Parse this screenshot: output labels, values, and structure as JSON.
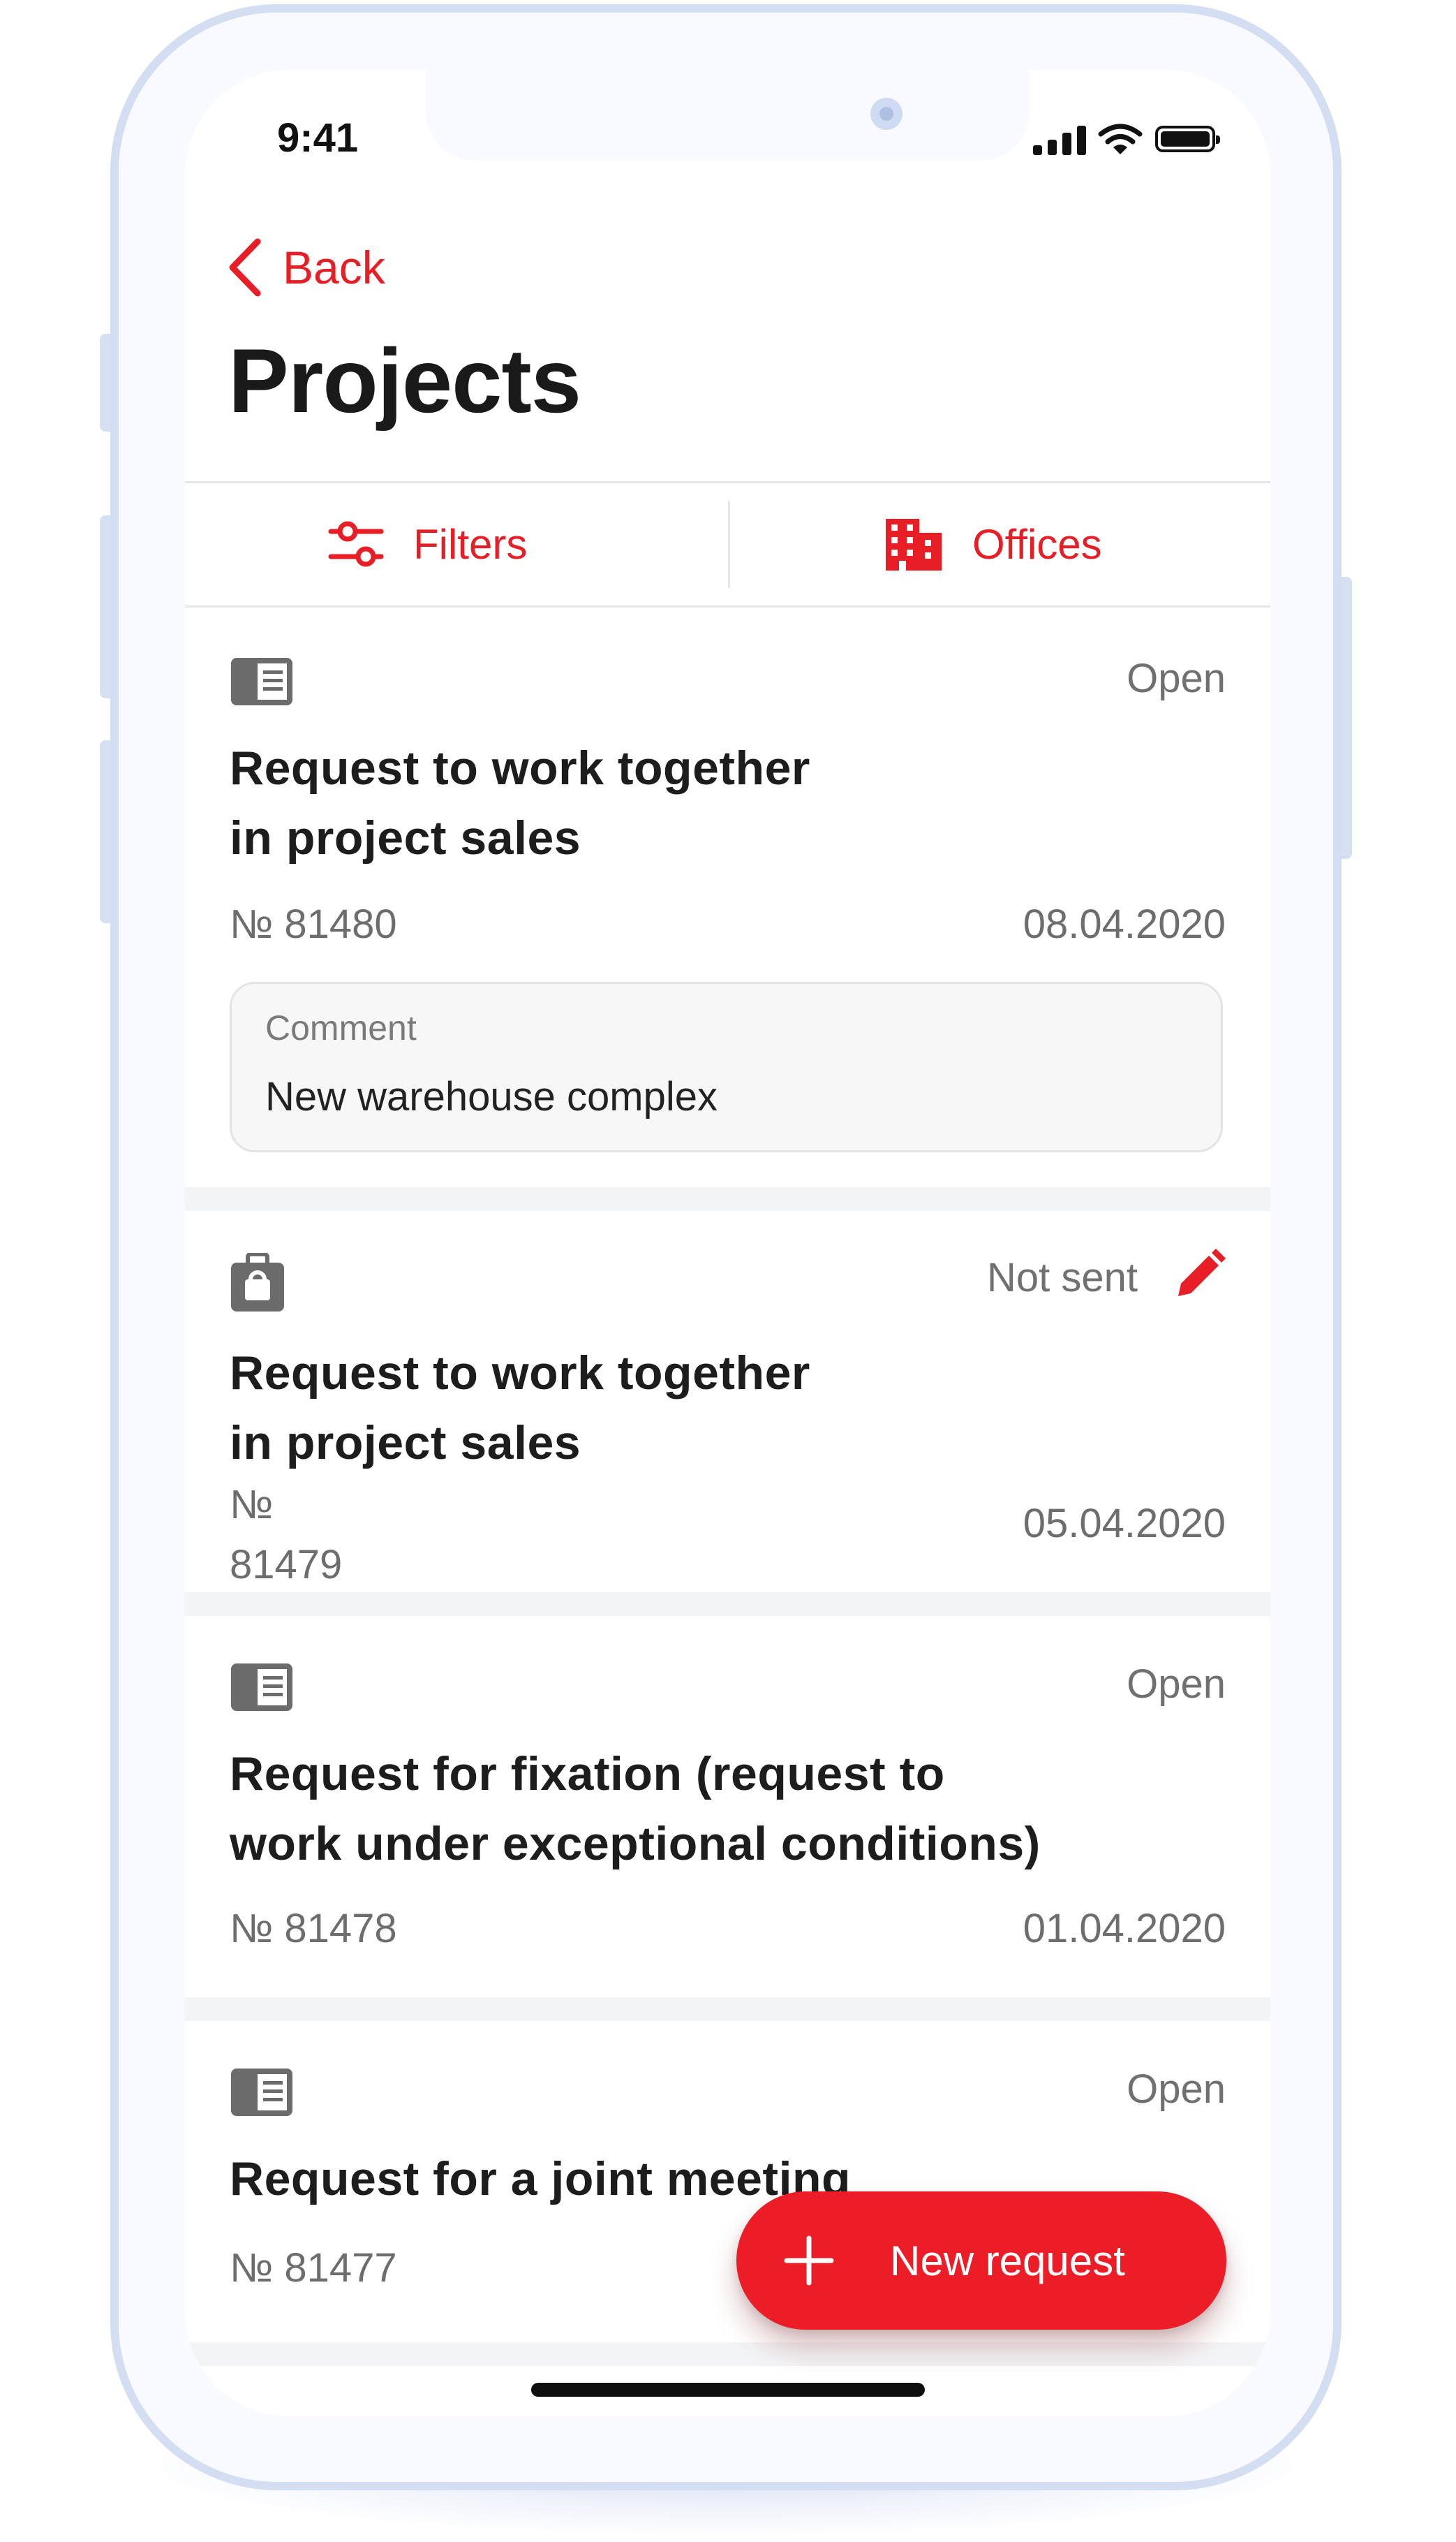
{
  "status_bar": {
    "time": "9:41"
  },
  "nav": {
    "back_label": "Back",
    "title": "Projects"
  },
  "filters": {
    "filters_label": "Filters",
    "offices_label": "Offices"
  },
  "requests": [
    {
      "icon": "document-list-icon",
      "status": "Open",
      "title_line1": "Request to work together",
      "title_line2": "in project sales",
      "number": "№ 81480",
      "date": "08.04.2020",
      "comment_label": "Comment",
      "comment": "New warehouse complex"
    },
    {
      "icon": "briefcase-icon",
      "status": "Not sent",
      "title_line1": "Request to work together",
      "title_line2": "in project sales",
      "number": "№ 81479",
      "date": "05.04.2020"
    },
    {
      "icon": "document-list-icon",
      "status": "Open",
      "title_line1": "Request for fixation (request to",
      "title_line2": "work under exceptional conditions)",
      "number": "№ 81478",
      "date": "01.04.2020"
    },
    {
      "icon": "document-list-icon",
      "status": "Open",
      "title_line1": "Request for a joint meeting",
      "number": "№ 81477"
    }
  ],
  "fab": {
    "label": "New request"
  },
  "colors": {
    "accent": "#E81E26",
    "text": "#1D1D1D",
    "muted": "#6D6D6D",
    "separator": "#F3F4F6"
  }
}
